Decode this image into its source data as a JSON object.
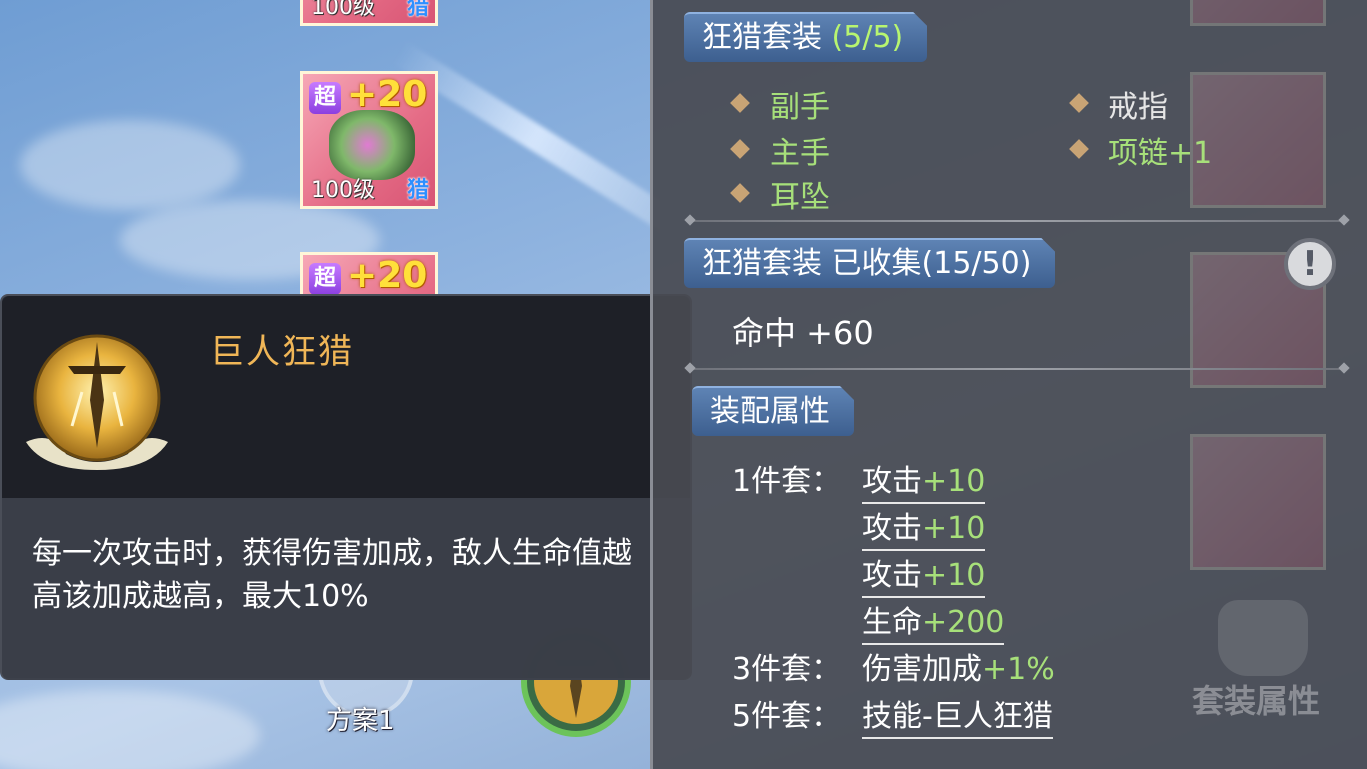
{
  "inventory": {
    "cards": [
      {
        "super": "",
        "plus": "",
        "level": "100级",
        "class": "猎"
      },
      {
        "super": "超",
        "plus": "+20",
        "level": "100级",
        "class": "猎"
      },
      {
        "super": "超",
        "plus": "+20",
        "level": "",
        "class": ""
      }
    ]
  },
  "tooltip": {
    "name": "巨人狂猎",
    "description": "每一次攻击时，获得伤害加成，敌人生命值越高该加成越高，最大10%",
    "icon": "giant-hunt-sword-icon"
  },
  "bottom": {
    "plan_label": "方案1"
  },
  "set_panel": {
    "tab_title": "狂猎套装",
    "tab_count": "(5/5)",
    "pieces_left": [
      "副手",
      "主手",
      "耳坠"
    ],
    "pieces_right": [
      "戒指",
      "项链+1"
    ],
    "collected_title": "狂猎套装 已收集(15/50)",
    "info_icon": "!",
    "collected_bonus": "命中 +60",
    "equip_title": "装配属性",
    "attrs": [
      {
        "label": "1件套：",
        "name": "攻击",
        "value": "+10"
      },
      {
        "label": "",
        "name": "攻击",
        "value": "+10"
      },
      {
        "label": "",
        "name": "攻击",
        "value": "+10"
      },
      {
        "label": "",
        "name": "生命",
        "value": "+200"
      },
      {
        "label": "3件套：",
        "name": "伤害加成",
        "value": "+1%"
      },
      {
        "label": "5件套：",
        "name": "技能-巨人狂猎",
        "value": ""
      }
    ],
    "set_attr_button": "套装属性"
  },
  "colors": {
    "tab_bg": "#4a6c9c",
    "green": "#a7e07a",
    "gold": "#f0b657"
  }
}
